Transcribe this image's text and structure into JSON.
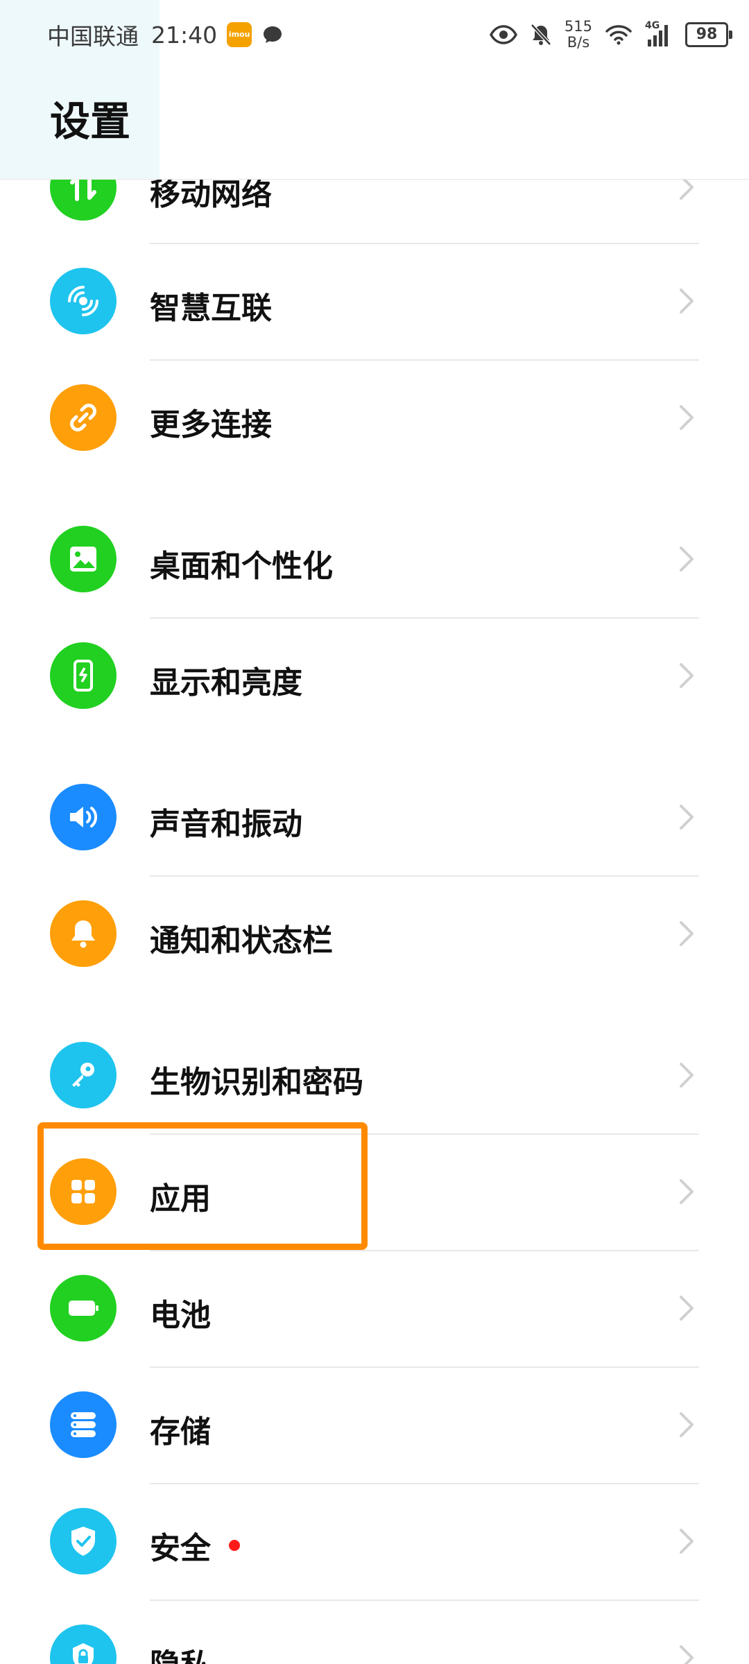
{
  "status_bar": {
    "carrier": "中国联通",
    "time": "21:40",
    "app_badge": "imou",
    "net_speed_value": "515",
    "net_speed_unit": "B/s",
    "network_type": "4G",
    "battery": "98"
  },
  "header": {
    "title": "设置"
  },
  "items": [
    {
      "label": "移动网络",
      "icon": "mobile-data-icon",
      "color": "#21d021"
    },
    {
      "label": "智慧互联",
      "icon": "smart-connect-icon",
      "color": "#1ec4ee"
    },
    {
      "label": "更多连接",
      "icon": "link-icon",
      "color": "#ff9f0a"
    },
    {
      "label": "桌面和个性化",
      "icon": "image-icon",
      "color": "#21d021"
    },
    {
      "label": "显示和亮度",
      "icon": "display-icon",
      "color": "#21d021"
    },
    {
      "label": "声音和振动",
      "icon": "speaker-icon",
      "color": "#1a8cff"
    },
    {
      "label": "通知和状态栏",
      "icon": "bell-icon",
      "color": "#ff9f0a"
    },
    {
      "label": "生物识别和密码",
      "icon": "key-icon",
      "color": "#1ec4ee"
    },
    {
      "label": "应用",
      "icon": "apps-grid-icon",
      "color": "#ff9f0a"
    },
    {
      "label": "电池",
      "icon": "battery-icon",
      "color": "#21d021"
    },
    {
      "label": "存储",
      "icon": "storage-icon",
      "color": "#1a8cff"
    },
    {
      "label": "安全",
      "icon": "shield-check-icon",
      "color": "#1ec4ee",
      "badge": "red-dot"
    },
    {
      "label": "隐私",
      "icon": "privacy-lock-icon",
      "color": "#1ec4ee"
    }
  ],
  "colors": {
    "highlight": "#ff8a00",
    "accent_orange": "#ff9f0a",
    "green": "#21d021",
    "blue": "#1a8cff",
    "cyan": "#1ec4ee"
  }
}
